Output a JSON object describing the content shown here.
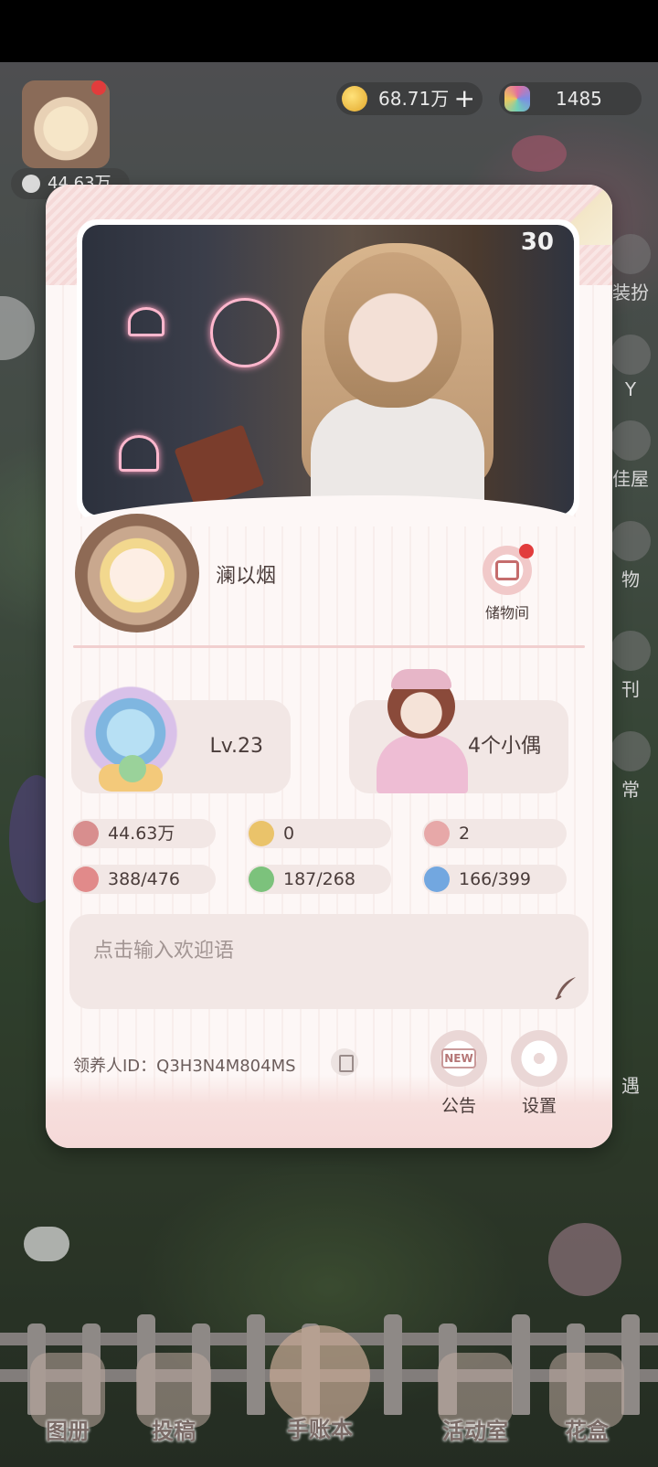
{
  "topbar": {
    "followers": "44.63万",
    "coins": "68.71万",
    "gems": "1485"
  },
  "side_menu": [
    "装扮",
    "Y",
    "佳屋",
    "物",
    "刊",
    "常",
    "遇"
  ],
  "bottom_nav": [
    {
      "label": "图册"
    },
    {
      "label": "投稿"
    },
    {
      "label": "手账本"
    },
    {
      "label": "活动室"
    },
    {
      "label": "花盒"
    }
  ],
  "card": {
    "photo_number": "30",
    "nickname": "澜以烟",
    "storage_label": "储物间",
    "level": "Lv.23",
    "dolls": "4个小偶",
    "stats": [
      {
        "icon": "person-icon",
        "value": "44.63万",
        "color": "#d88e8e"
      },
      {
        "icon": "footprint-icon",
        "value": "0",
        "color": "#eac36a"
      },
      {
        "icon": "heart-icon",
        "value": "2",
        "color": "#e7a8a8"
      },
      {
        "icon": "dress-icon",
        "value": "388/476",
        "color": "#e18a8a"
      },
      {
        "icon": "furniture-icon",
        "value": "187/268",
        "color": "#7cc27c"
      },
      {
        "icon": "bag-icon",
        "value": "166/399",
        "color": "#72a7e0"
      }
    ],
    "welcome_placeholder": "点击输入欢迎语",
    "adopter_label": "领养人ID：",
    "adopter_id": "Q3H3N4M804MS",
    "notice_label": "公告",
    "notice_tag": "NEW",
    "settings_label": "设置"
  }
}
